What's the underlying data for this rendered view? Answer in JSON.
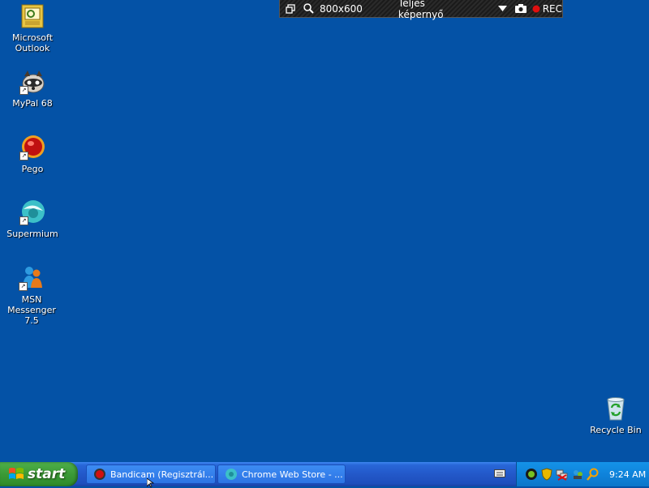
{
  "recorder": {
    "resolution": "800x600",
    "mode": "Teljes képernyő",
    "rec_label": "REC"
  },
  "desktop": {
    "icons": [
      {
        "label": "Microsoft\nOutlook",
        "icon": "outlook-icon"
      },
      {
        "label": "MyPal 68",
        "icon": "mypal-icon"
      },
      {
        "label": "Pego",
        "icon": "pego-icon"
      },
      {
        "label": "Supermium",
        "icon": "supermium-icon"
      },
      {
        "label": "MSN Messenger\n7.5",
        "icon": "msn-messenger-icon"
      },
      {
        "label": "Recycle Bin",
        "icon": "recycle-bin-icon"
      }
    ]
  },
  "taskbar": {
    "start_label": "start",
    "tasks": [
      {
        "label": "Bandicam (Regisztrál...",
        "active": true
      },
      {
        "label": "Chrome Web Store - ...",
        "active": false
      }
    ],
    "clock": "9:24 AM"
  },
  "colors": {
    "desktop": "#0452a6",
    "start": "#3b9a36",
    "tray": "#0f83db",
    "rec_dot": "#e01010"
  }
}
